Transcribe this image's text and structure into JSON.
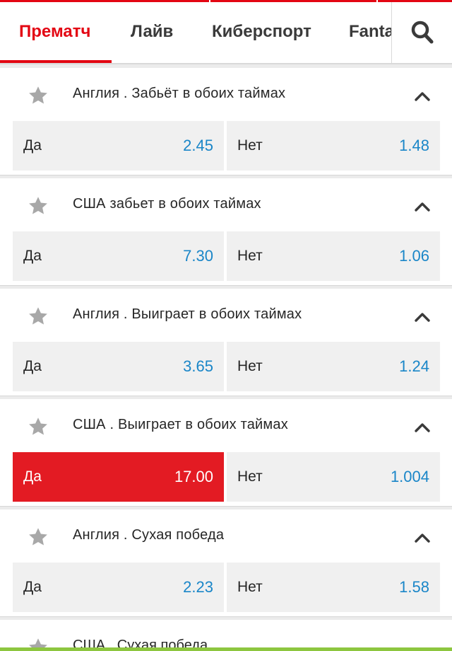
{
  "tabs": [
    {
      "label": "Прематч",
      "active": true
    },
    {
      "label": "Лайв",
      "active": false
    },
    {
      "label": "Киберспорт",
      "active": false
    },
    {
      "label": "Fanta",
      "active": false
    }
  ],
  "markets": [
    {
      "title": "Англия . Забьёт в обоих таймах",
      "odds": [
        {
          "label": "Да",
          "value": "2.45"
        },
        {
          "label": "Нет",
          "value": "1.48"
        }
      ]
    },
    {
      "title": "США забьет в обоих таймах",
      "odds": [
        {
          "label": "Да",
          "value": "7.30"
        },
        {
          "label": "Нет",
          "value": "1.06"
        }
      ]
    },
    {
      "title": "Англия . Выиграет в обоих таймах",
      "odds": [
        {
          "label": "Да",
          "value": "3.65"
        },
        {
          "label": "Нет",
          "value": "1.24"
        }
      ]
    },
    {
      "title": "США . Выиграет в обоих таймах",
      "odds": [
        {
          "label": "Да",
          "value": "17.00"
        },
        {
          "label": "Нет",
          "value": "1.004"
        }
      ]
    },
    {
      "title": "Англия . Сухая победа",
      "odds": [
        {
          "label": "Да",
          "value": "2.23"
        },
        {
          "label": "Нет",
          "value": "1.58"
        }
      ]
    }
  ],
  "partial_market": {
    "title": "США . Сухая победа"
  },
  "selected_odd": {
    "market": 3,
    "option": 0
  },
  "icons": {
    "favorite": "star-icon",
    "collapse": "chevron-up-icon",
    "search": "search-icon"
  },
  "colors": {
    "accent": "#e30613",
    "odd_value": "#1a86c8",
    "selected_bg": "#e31b23",
    "bottom_bar": "#8dc63f"
  }
}
